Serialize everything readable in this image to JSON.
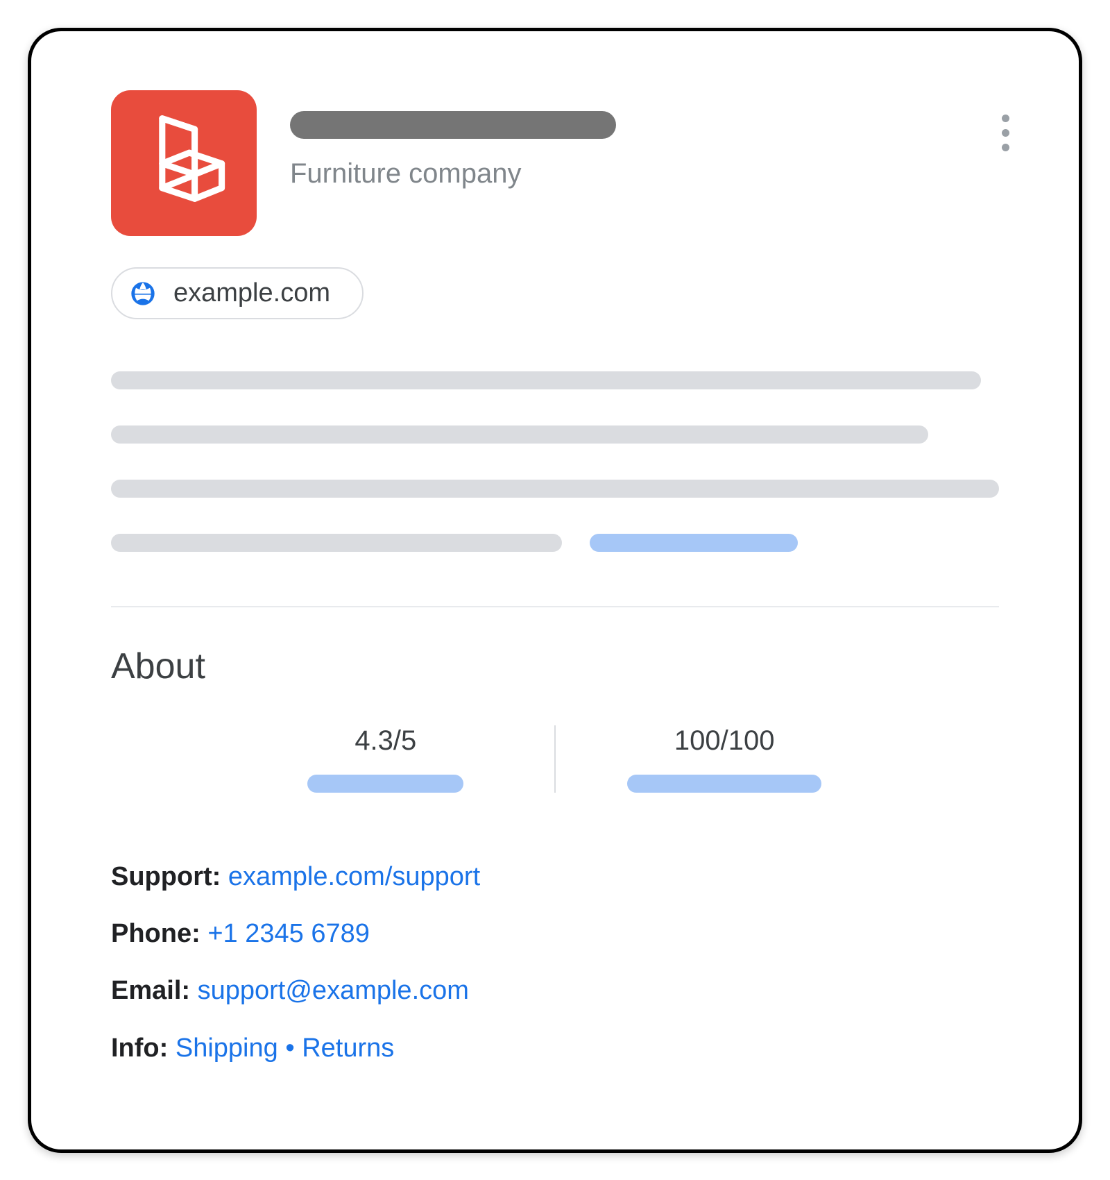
{
  "header": {
    "subtitle": "Furniture company",
    "website": "example.com"
  },
  "about": {
    "title": "About",
    "rating": "4.3/5",
    "score": "100/100"
  },
  "contact": {
    "support_label": "Support:",
    "support_link": "example.com/support",
    "phone_label": "Phone:",
    "phone_link": "+1 2345 6789",
    "email_label": "Email:",
    "email_link": "support@example.com",
    "info_label": "Info:",
    "info_link_1": "Shipping",
    "info_sep": " • ",
    "info_link_2": "Returns"
  }
}
